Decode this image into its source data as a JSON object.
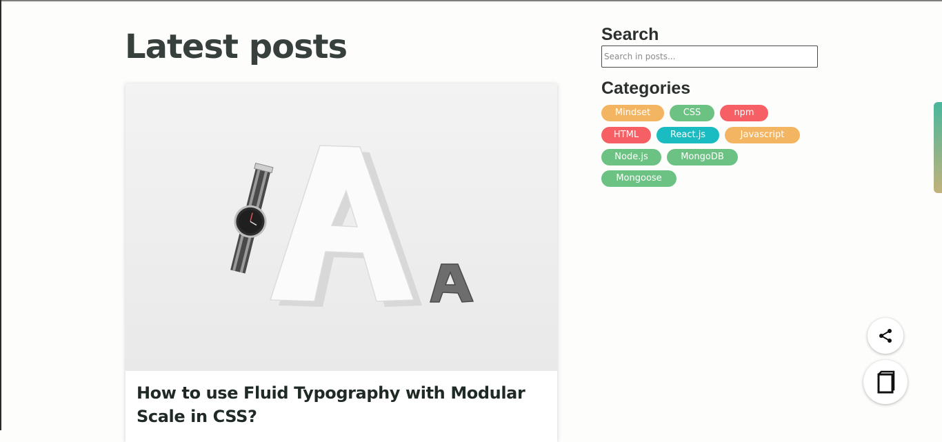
{
  "main": {
    "title": "Latest posts",
    "posts": [
      {
        "title": "How to use Fluid Typography with Modular Scale in CSS?",
        "image_alt": "Wristwatch next to large letter A and small letter A"
      }
    ]
  },
  "sidebar": {
    "search": {
      "heading": "Search",
      "placeholder": "Search in posts..."
    },
    "categories": {
      "heading": "Categories",
      "items": [
        {
          "label": "Mindset",
          "color": "#f3b562"
        },
        {
          "label": "CSS",
          "color": "#6cc283"
        },
        {
          "label": "npm",
          "color": "#f65f63"
        },
        {
          "label": "HTML",
          "color": "#f65f63"
        },
        {
          "label": "React.js",
          "color": "#1bbbc2"
        },
        {
          "label": "Javascript",
          "color": "#f3b562"
        },
        {
          "label": "Node.js",
          "color": "#6cc283"
        },
        {
          "label": "MongoDB",
          "color": "#6cc283"
        },
        {
          "label": "Mongoose",
          "color": "#6cc283"
        }
      ]
    }
  },
  "floating_actions": {
    "share_icon": "share-icon",
    "book_icon": "book-icon"
  },
  "colors": {
    "accent_gradient_start": "#49b79c",
    "accent_gradient_end": "#c2b27b",
    "title_text": "#37403d"
  }
}
